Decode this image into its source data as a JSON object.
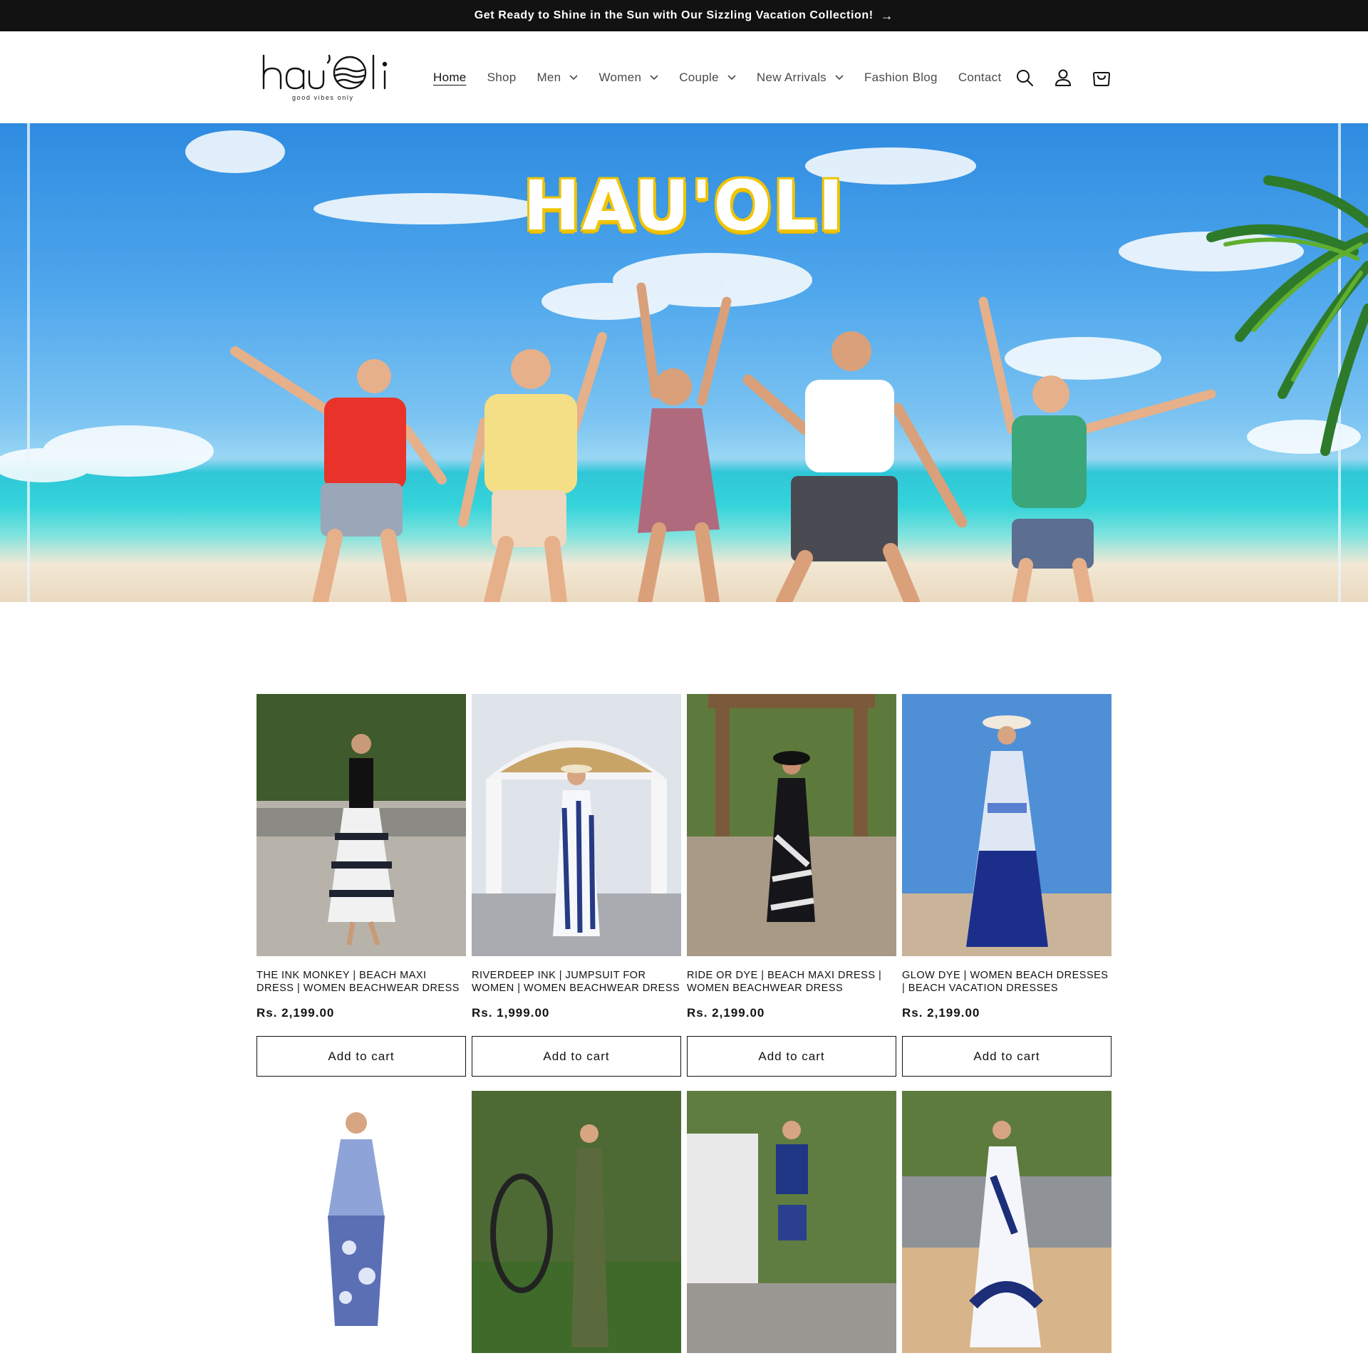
{
  "announcement": {
    "text": "Get Ready to Shine in the Sun with Our Sizzling Vacation Collection!",
    "arrow": "→"
  },
  "brand": {
    "logo_text": "hau'oli",
    "tagline": "good vibes only"
  },
  "nav": {
    "items": [
      {
        "label": "Home",
        "active": true,
        "dropdown": false
      },
      {
        "label": "Shop",
        "active": false,
        "dropdown": false
      },
      {
        "label": "Men",
        "active": false,
        "dropdown": true
      },
      {
        "label": "Women",
        "active": false,
        "dropdown": true
      },
      {
        "label": "Couple",
        "active": false,
        "dropdown": true
      },
      {
        "label": "New Arrivals",
        "active": false,
        "dropdown": true
      },
      {
        "label": "Fashion Blog",
        "active": false,
        "dropdown": false
      },
      {
        "label": "Contact",
        "active": false,
        "dropdown": false
      }
    ],
    "icons": [
      "search-icon",
      "account-icon",
      "cart-icon"
    ]
  },
  "hero": {
    "title": "HAU'OLI"
  },
  "products": [
    {
      "title": "THE INK MONKEY | BEACH MAXI DRESS | WOMEN BEACHWEAR DRESS",
      "price": "Rs. 2,199.00",
      "button": "Add to cart"
    },
    {
      "title": "RIVERDEEP INK | JUMPSUIT FOR WOMEN | WOMEN BEACHWEAR DRESS",
      "price": "Rs. 1,999.00",
      "button": "Add to cart"
    },
    {
      "title": "RIDE OR DYE | BEACH MAXI DRESS | WOMEN BEACHWEAR DRESS",
      "price": "Rs. 2,199.00",
      "button": "Add to cart"
    },
    {
      "title": "GLOW DYE | WOMEN BEACH DRESSES | BEACH VACATION DRESSES",
      "price": "Rs. 2,199.00",
      "button": "Add to cart"
    },
    {
      "title": "",
      "price": "",
      "button": ""
    },
    {
      "title": "",
      "price": "",
      "button": ""
    },
    {
      "title": "",
      "price": "",
      "button": ""
    },
    {
      "title": "",
      "price": "",
      "button": ""
    }
  ],
  "colors": {
    "announce_bg": "#121212",
    "text": "#121212",
    "nav_text": "#4a4a4a",
    "hero_title_outline": "#f0c400"
  }
}
